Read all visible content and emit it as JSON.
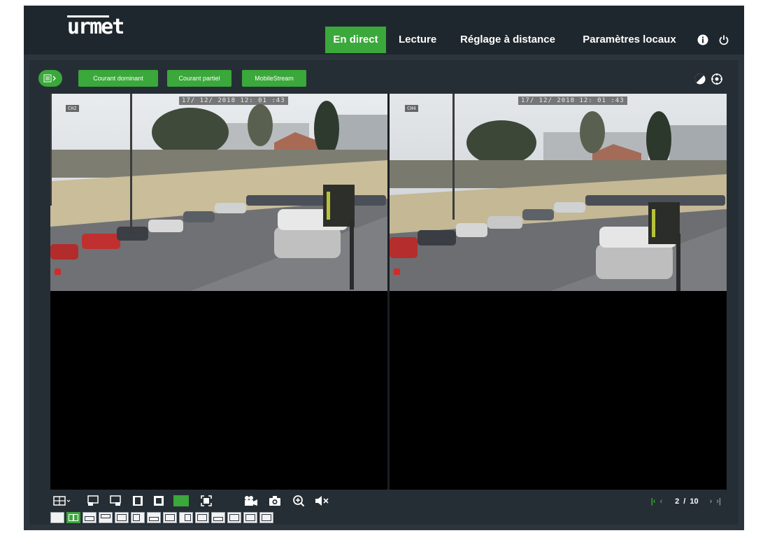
{
  "brand": {
    "logo_text": "urmet"
  },
  "nav": {
    "tabs": [
      {
        "label": "En direct",
        "active": true
      },
      {
        "label": "Lecture",
        "active": false
      },
      {
        "label": "Réglage à distance",
        "active": false
      },
      {
        "label": "Paramètres locaux",
        "active": false
      }
    ],
    "icons": [
      "info-icon",
      "power-icon"
    ]
  },
  "stream_buttons": {
    "main": "Courant dominant",
    "sub": "Courant partiel",
    "mobile": "MobileStream"
  },
  "channels": [
    {
      "label": "CH2",
      "timestamp": "17/ 12/ 2018  12: 01 :43",
      "recording": true
    },
    {
      "label": "CH4",
      "timestamp": "17/ 12/ 2018  12: 01 :43",
      "recording": true
    }
  ],
  "pager": {
    "current": "2",
    "separator": "/",
    "total": "10"
  },
  "colors": {
    "accent": "#3aa83a",
    "background": "#313a43",
    "topbar": "#1f272e"
  }
}
